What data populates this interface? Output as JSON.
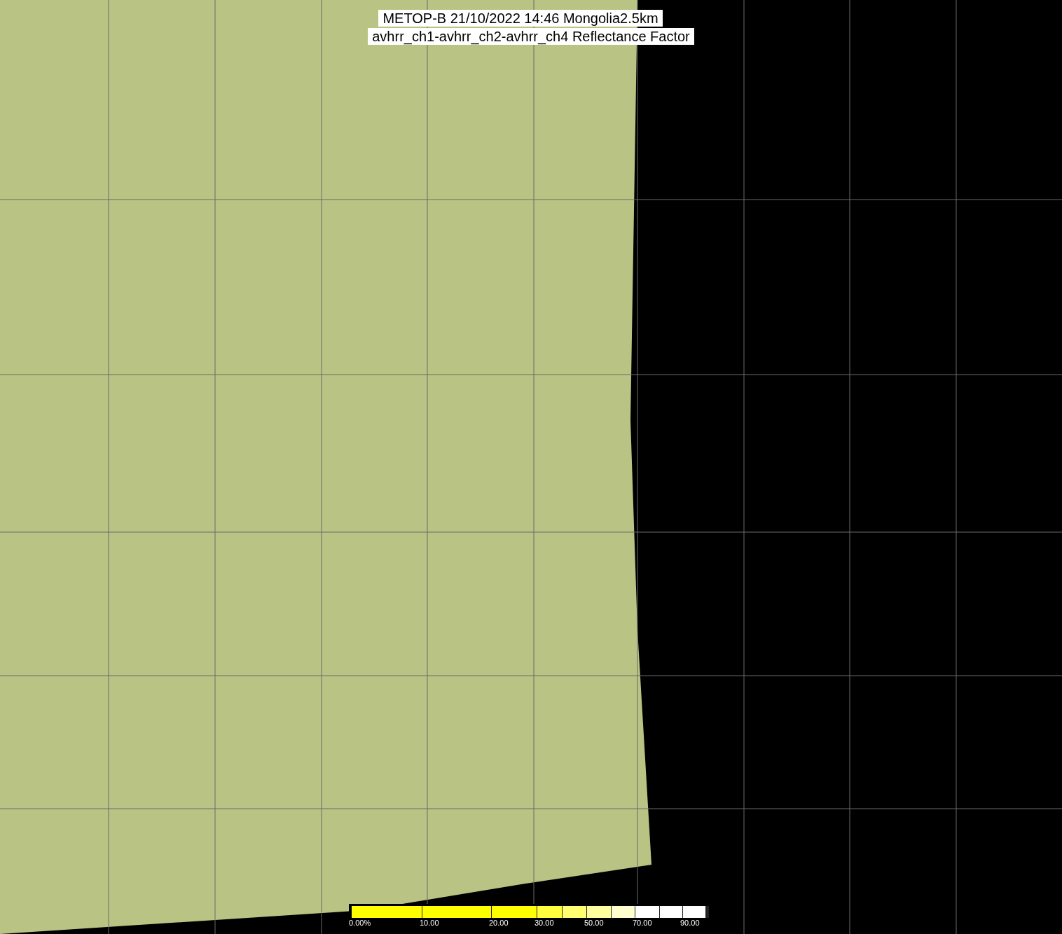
{
  "title": {
    "line_1": "METOP-B 21/10/2022 14:46 Mongolia2.5km",
    "line_2": "avhrr_ch1-avhrr_ch2-avhrr_ch4 Reflectance Factor"
  },
  "legend": {
    "segments": [
      {
        "color": "#ffff00",
        "label": "0.00%"
      },
      {
        "color": "#ffff00",
        "label": "10.00"
      },
      {
        "color": "#ffff00",
        "label": "20.00"
      },
      {
        "color": "#ffff40",
        "label": "30.00"
      },
      {
        "color": "#ffff70"
      },
      {
        "color": "#ffffa0",
        "label": "50.00"
      },
      {
        "color": "#ffffd0"
      },
      {
        "color": "#ffffff",
        "label": "70.00"
      },
      {
        "color": "#ffffff"
      },
      {
        "color": "#ffffff",
        "label": "90.00"
      }
    ]
  }
}
